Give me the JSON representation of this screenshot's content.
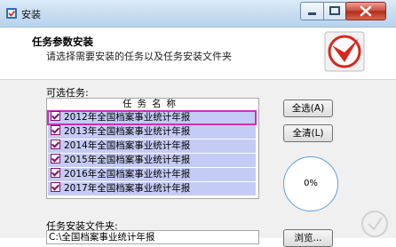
{
  "window": {
    "title": "安装"
  },
  "header": {
    "title": "任务参数安装",
    "subtitle": "请选择需要安装的任务以及任务安装文件夹"
  },
  "tasks": {
    "label": "可选任务:",
    "column_header": "任务名称",
    "items": [
      {
        "label": "2012年全国档案事业统计年报",
        "checked": true
      },
      {
        "label": "2013年全国档案事业统计年报",
        "checked": true
      },
      {
        "label": "2014年全国档案事业统计年报",
        "checked": true
      },
      {
        "label": "2015年全国档案事业统计年报",
        "checked": true
      },
      {
        "label": "2016年全国档案事业统计年报",
        "checked": true
      },
      {
        "label": "2017年全国档案事业统计年报",
        "checked": true
      }
    ]
  },
  "buttons": {
    "select_all": "全选(A)",
    "clear_all": "全清(L)",
    "browse": "浏览..."
  },
  "progress": {
    "text": "0%"
  },
  "folder": {
    "label": "任务安装文件夹:",
    "value": "C:\\全国档案事业统计年报"
  },
  "icons": {
    "app": "installer-icon",
    "logo": "red-checkmark-logo",
    "minimize": "minimize-icon",
    "maximize": "maximize-icon",
    "close": "close-icon"
  },
  "colors": {
    "selection": "#c4cbf4",
    "focus_outline": "#c433b8",
    "checkbox": "#8c0c6a",
    "logo_red": "#d8261e",
    "close_red": "#c9483a"
  }
}
